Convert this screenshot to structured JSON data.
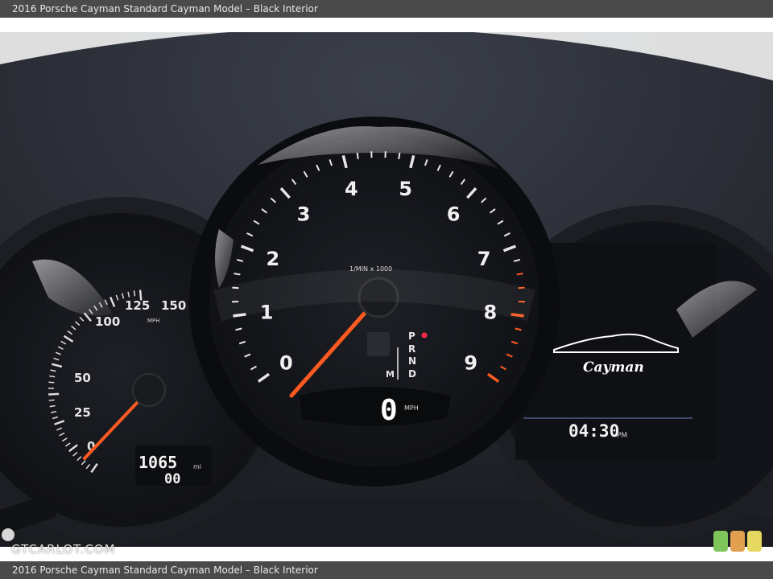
{
  "caption": "2016 Porsche Cayman Standard Cayman Model – Black Interior",
  "watermark": "GTCARLOT.COM",
  "tachometer": {
    "numerals": [
      "0",
      "1",
      "2",
      "3",
      "4",
      "5",
      "6",
      "7",
      "8",
      "9"
    ],
    "unit_label": "1/MIN x 1000",
    "gear_selector": [
      "P",
      "R",
      "N",
      "D"
    ],
    "gear_manual": "M",
    "digital_speed": "0",
    "digital_speed_unit": "MPH",
    "needle_value": 0
  },
  "speedometer": {
    "tick_labels": [
      "0",
      "25",
      "50",
      "100",
      "125",
      "150"
    ],
    "unit_label": "MPH",
    "odometer": "1065",
    "odometer_unit": "mi",
    "trip": "00",
    "needle_value": 0
  },
  "right_display": {
    "logo_text": "Cayman",
    "clock_time": "04:30",
    "clock_period": "PM"
  },
  "colors": {
    "needle": "#ff5a1f",
    "redline_tick": "#ff5a1f",
    "gear_p_dot": "#ff2a4a",
    "dial_face": "#15171c",
    "bezel": "#0b0c0f",
    "dashboard": "#2b2e36"
  }
}
